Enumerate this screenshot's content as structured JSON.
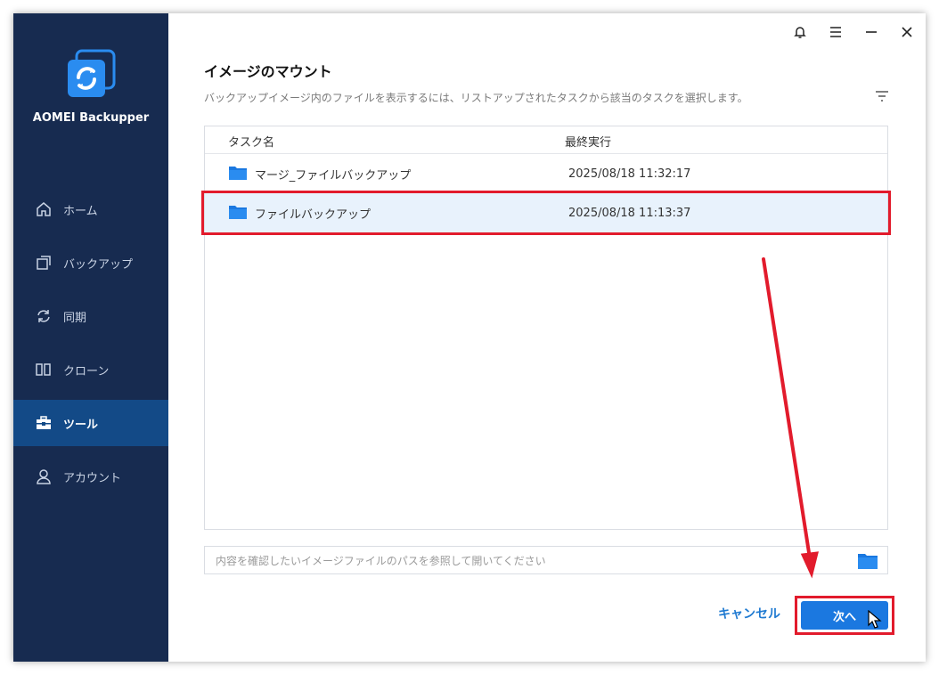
{
  "app": {
    "name": "AOMEI Backupper"
  },
  "sidebar": {
    "items": [
      {
        "id": "home",
        "label": "ホーム",
        "icon": "home-icon"
      },
      {
        "id": "backup",
        "label": "バックアップ",
        "icon": "backup-icon"
      },
      {
        "id": "sync",
        "label": "同期",
        "icon": "sync-icon"
      },
      {
        "id": "clone",
        "label": "クローン",
        "icon": "clone-icon"
      },
      {
        "id": "tools",
        "label": "ツール",
        "icon": "toolbox-icon",
        "active": true
      },
      {
        "id": "account",
        "label": "アカウント",
        "icon": "user-icon"
      }
    ]
  },
  "titlebar": {
    "icons": [
      "bell-icon",
      "menu-icon",
      "minimize-icon",
      "close-icon"
    ]
  },
  "page": {
    "title": "イメージのマウント",
    "description": "バックアップイメージ内のファイルを表示するには、リストアップされたタスクから該当のタスクを選択します。"
  },
  "table": {
    "headers": [
      "タスク名",
      "最終実行"
    ],
    "rows": [
      {
        "name": "マージ_ファイルバックアップ",
        "time": "2025/08/18 11:32:17",
        "selected": false
      },
      {
        "name": "ファイルバックアップ",
        "time": "2025/08/18 11:13:37",
        "selected": true
      }
    ]
  },
  "path": {
    "placeholder": "内容を確認したいイメージファイルのパスを参照して開いてください",
    "value": ""
  },
  "buttons": {
    "cancel": "キャンセル",
    "next": "次へ"
  },
  "colors": {
    "sidebar_bg": "#172b50",
    "sidebar_active": "#134a87",
    "accent": "#1b78e0",
    "annotation_red": "#e21b2c",
    "folder_blue": "#2a8cf0"
  }
}
